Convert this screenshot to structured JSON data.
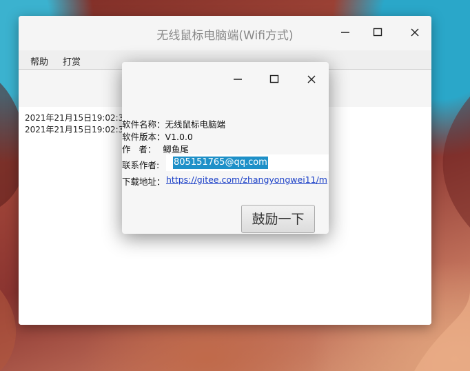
{
  "main_window": {
    "title": "无线鼠标电脑端(Wifi方式)",
    "menu": [
      "帮助",
      "打赏"
    ],
    "log_lines": [
      "2021年21月15日19:02:3",
      "2021年21月15日19:02:3"
    ]
  },
  "about_dialog": {
    "software_name_label": "软件名称：",
    "software_name": "无线鼠标电脑端",
    "version_label": "软件版本：",
    "version": "V1.0.0",
    "author_label": "作   者：",
    "author": "鲫鱼尾",
    "contact_label": "联系作者:",
    "contact_email": "805151765@qq.com",
    "download_label": "下载地址：",
    "download_url": "https://gitee.com/zhangyongwei11/m",
    "reward_button": "鼓励一下"
  },
  "icons": {
    "minimize": "minimize-icon",
    "maximize": "maximize-icon",
    "close": "close-icon"
  }
}
